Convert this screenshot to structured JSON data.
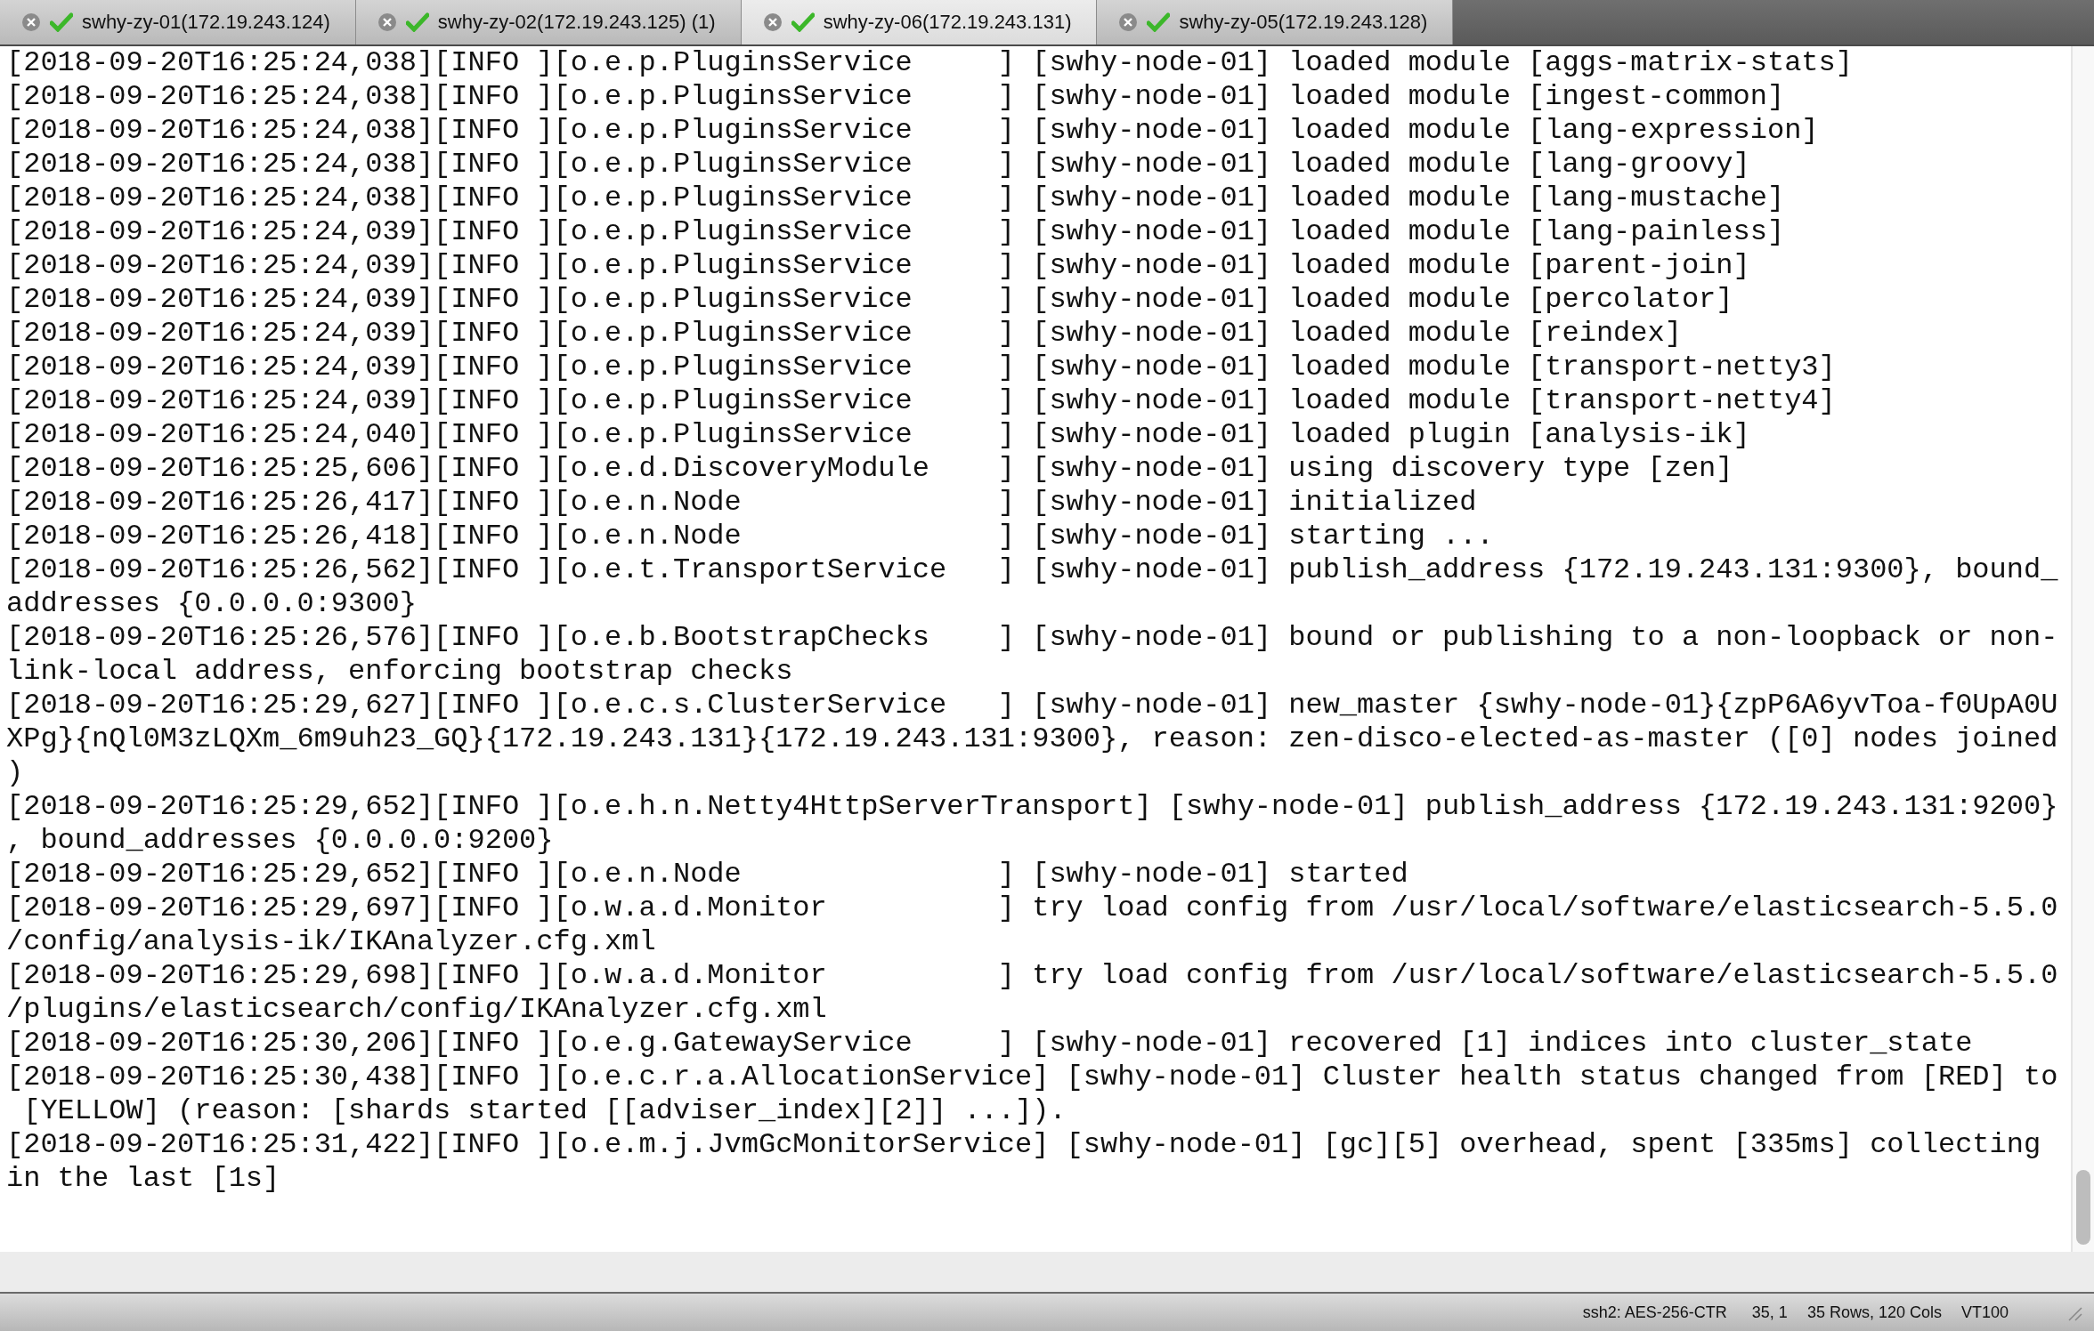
{
  "tabs": [
    {
      "label": "swhy-zy-01(172.19.243.124)",
      "selected": false,
      "connected": true
    },
    {
      "label": "swhy-zy-02(172.19.243.125) (1)",
      "selected": false,
      "connected": true
    },
    {
      "label": "swhy-zy-06(172.19.243.131)",
      "selected": true,
      "connected": true
    },
    {
      "label": "swhy-zy-05(172.19.243.128)",
      "selected": false,
      "connected": true
    }
  ],
  "terminal": {
    "lines": [
      "[2018-09-20T16:25:24,038][INFO ][o.e.p.PluginsService     ] [swhy-node-01] loaded module [aggs-matrix-stats]",
      "[2018-09-20T16:25:24,038][INFO ][o.e.p.PluginsService     ] [swhy-node-01] loaded module [ingest-common]",
      "[2018-09-20T16:25:24,038][INFO ][o.e.p.PluginsService     ] [swhy-node-01] loaded module [lang-expression]",
      "[2018-09-20T16:25:24,038][INFO ][o.e.p.PluginsService     ] [swhy-node-01] loaded module [lang-groovy]",
      "[2018-09-20T16:25:24,038][INFO ][o.e.p.PluginsService     ] [swhy-node-01] loaded module [lang-mustache]",
      "[2018-09-20T16:25:24,039][INFO ][o.e.p.PluginsService     ] [swhy-node-01] loaded module [lang-painless]",
      "[2018-09-20T16:25:24,039][INFO ][o.e.p.PluginsService     ] [swhy-node-01] loaded module [parent-join]",
      "[2018-09-20T16:25:24,039][INFO ][o.e.p.PluginsService     ] [swhy-node-01] loaded module [percolator]",
      "[2018-09-20T16:25:24,039][INFO ][o.e.p.PluginsService     ] [swhy-node-01] loaded module [reindex]",
      "[2018-09-20T16:25:24,039][INFO ][o.e.p.PluginsService     ] [swhy-node-01] loaded module [transport-netty3]",
      "[2018-09-20T16:25:24,039][INFO ][o.e.p.PluginsService     ] [swhy-node-01] loaded module [transport-netty4]",
      "[2018-09-20T16:25:24,040][INFO ][o.e.p.PluginsService     ] [swhy-node-01] loaded plugin [analysis-ik]",
      "[2018-09-20T16:25:25,606][INFO ][o.e.d.DiscoveryModule    ] [swhy-node-01] using discovery type [zen]",
      "[2018-09-20T16:25:26,417][INFO ][o.e.n.Node               ] [swhy-node-01] initialized",
      "[2018-09-20T16:25:26,418][INFO ][o.e.n.Node               ] [swhy-node-01] starting ...",
      "[2018-09-20T16:25:26,562][INFO ][o.e.t.TransportService   ] [swhy-node-01] publish_address {172.19.243.131:9300}, bound_",
      "addresses {0.0.0.0:9300}",
      "[2018-09-20T16:25:26,576][INFO ][o.e.b.BootstrapChecks    ] [swhy-node-01] bound or publishing to a non-loopback or non-",
      "link-local address, enforcing bootstrap checks",
      "[2018-09-20T16:25:29,627][INFO ][o.e.c.s.ClusterService   ] [swhy-node-01] new_master {swhy-node-01}{zpP6A6yvToa-f0UpA0U",
      "XPg}{nQl0M3zLQXm_6m9uh23_GQ}{172.19.243.131}{172.19.243.131:9300}, reason: zen-disco-elected-as-master ([0] nodes joined",
      ")",
      "[2018-09-20T16:25:29,652][INFO ][o.e.h.n.Netty4HttpServerTransport] [swhy-node-01] publish_address {172.19.243.131:9200}",
      ", bound_addresses {0.0.0.0:9200}",
      "[2018-09-20T16:25:29,652][INFO ][o.e.n.Node               ] [swhy-node-01] started",
      "[2018-09-20T16:25:29,697][INFO ][o.w.a.d.Monitor          ] try load config from /usr/local/software/elasticsearch-5.5.0",
      "/config/analysis-ik/IKAnalyzer.cfg.xml",
      "[2018-09-20T16:25:29,698][INFO ][o.w.a.d.Monitor          ] try load config from /usr/local/software/elasticsearch-5.5.0",
      "/plugins/elasticsearch/config/IKAnalyzer.cfg.xml",
      "[2018-09-20T16:25:30,206][INFO ][o.e.g.GatewayService     ] [swhy-node-01] recovered [1] indices into cluster_state",
      "[2018-09-20T16:25:30,438][INFO ][o.e.c.r.a.AllocationService] [swhy-node-01] Cluster health status changed from [RED] to",
      " [YELLOW] (reason: [shards started [[adviser_index][2]] ...]).",
      "[2018-09-20T16:25:31,422][INFO ][o.e.m.j.JvmGcMonitorService] [swhy-node-01] [gc][5] overhead, spent [335ms] collecting",
      "in the last [1s]"
    ]
  },
  "status_bar": {
    "cipher": "ssh2: AES-256-CTR",
    "cursor": "35, 1",
    "size": "35 Rows, 120 Cols",
    "emulation": "VT100"
  }
}
